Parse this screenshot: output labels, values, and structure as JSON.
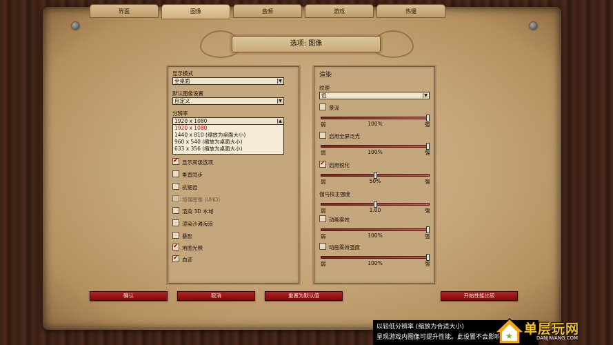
{
  "tabs": [
    {
      "label": "界面"
    },
    {
      "label": "图像"
    },
    {
      "label": "音频"
    },
    {
      "label": "游戏"
    },
    {
      "label": "热键"
    }
  ],
  "active_tab": "图像",
  "title": "选项: 图像",
  "left": {
    "display_mode_label": "显示模式",
    "display_mode_value": "全桌面",
    "default_settings_label": "默认图像设置",
    "default_settings_value": "自定义",
    "resolution_label": "分辨率",
    "resolution_value": "1920 x 1080",
    "resolution_options": [
      "1920 x 1080",
      "1440 x 810 (缩放为桌面大小)",
      "960 x 540 (缩放为桌面大小)",
      "633 x 356 (缩放为桌面大小)"
    ],
    "checkboxes": [
      {
        "label": "显示高级选项",
        "checked": true,
        "enabled": true
      },
      {
        "label": "垂直同步",
        "checked": false,
        "enabled": true
      },
      {
        "label": "抗锯齿",
        "checked": false,
        "enabled": true
      },
      {
        "label": "增强图像 (UHD)",
        "checked": false,
        "enabled": false
      },
      {
        "label": "渲染 3D 水域",
        "checked": false,
        "enabled": true
      },
      {
        "label": "渲染沙滩海浪",
        "checked": false,
        "enabled": true
      },
      {
        "label": "暴影",
        "checked": false,
        "enabled": true
      },
      {
        "label": "地图光照",
        "checked": true,
        "enabled": true
      },
      {
        "label": "血迹",
        "checked": true,
        "enabled": true
      }
    ]
  },
  "right": {
    "heading": "渲染",
    "texture_label": "纹理",
    "texture_value": "低",
    "settings": [
      {
        "check_label": "景深",
        "checked": false,
        "value_text": "100%",
        "fraction": 1.0
      },
      {
        "check_label": "启用全屏泛光",
        "checked": false,
        "value_text": "100%",
        "fraction": 1.0
      },
      {
        "check_label": "启用锐化",
        "checked": true,
        "value_text": "50%",
        "fraction": 0.5
      },
      {
        "label": "伽马校正强度",
        "value_text": "1.00",
        "fraction": 0.5
      },
      {
        "check_label": "动画雾效",
        "checked": false,
        "value_text": "100%",
        "fraction": 1.0
      },
      {
        "check_label": "动画雾效强度",
        "checked": false,
        "value_text": "100%",
        "fraction": 1.0
      }
    ],
    "weak": "弱",
    "strong": "强"
  },
  "buttons": {
    "ok": "确认",
    "cancel": "取消",
    "reset": "重置为默认值",
    "benchmark": "开始性能比较"
  },
  "tooltip": {
    "line1": "以较低分辨率 (缩放为合适大小)",
    "line2": "呈现游戏内图像可提升性能。此设置不会影响 UI."
  },
  "logo": {
    "text": "单层玩网",
    "sub": "DANJIWANG.COM"
  },
  "colors": {
    "accent_red": "#b52222",
    "parchment": "#c7a77a"
  }
}
